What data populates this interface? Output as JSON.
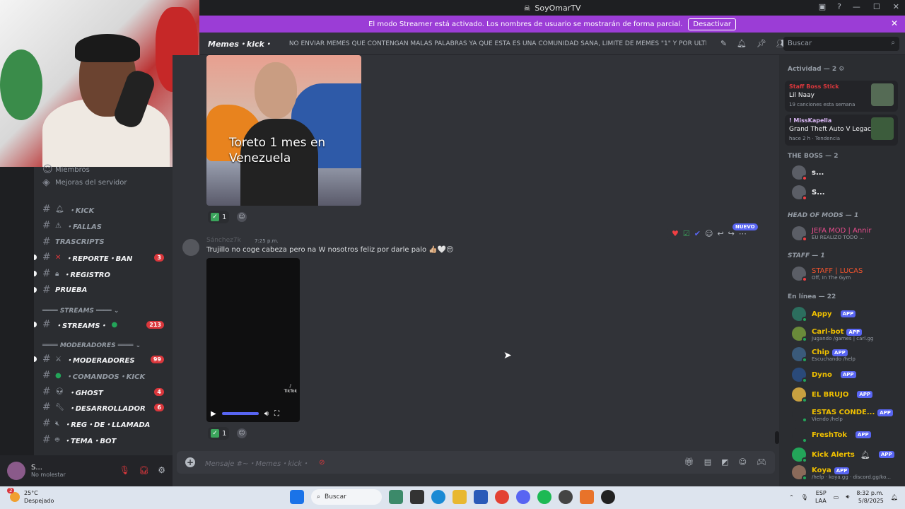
{
  "window": {
    "title": "SoyOmarTV"
  },
  "banner": {
    "text": "El modo Streamer está activado. Los nombres de usuario se mostrarán de forma parcial.",
    "button": "Desactivar"
  },
  "channel_header": {
    "name": "Memes・kick・",
    "topic": "NO ENVIAR MEMES QUE CONTENGAN MALAS PALABRAS YA QUE ESTA ES UNA COMUNIDAD SANA, LIMITE DE MEMES \"1\" Y POR ULTIMO EL ...",
    "search_placeholder": "Buscar"
  },
  "sidebar": {
    "partial_item": "Miembros",
    "boost_item": "Mejoras del servidor",
    "channels": [
      {
        "label": "・KICK",
        "badge": ""
      },
      {
        "label": "・FALLAS",
        "badge": ""
      },
      {
        "label": "TRASCRIPTS",
        "badge": ""
      },
      {
        "label": "・REPORTE・BAN",
        "badge": "3"
      },
      {
        "label": "・REGISTRO",
        "badge": ""
      },
      {
        "label": "PRUEBA",
        "badge": ""
      },
      {
        "label": "・STREAMS・",
        "badge": "213"
      },
      {
        "label": "・MODERADORES",
        "badge": "99"
      },
      {
        "label": "・COMANDOS・KICK",
        "badge": ""
      },
      {
        "label": "・GHOST",
        "badge": "4"
      },
      {
        "label": "・DESARROLLADOR",
        "badge": "6"
      },
      {
        "label": "・REG・DE・LLAMADA",
        "badge": ""
      },
      {
        "label": "・TEMA・BOT",
        "badge": ""
      }
    ],
    "categories": [
      "STREAMS",
      "MODERADORES"
    ],
    "user": {
      "name": "S...",
      "status": "No molestar"
    }
  },
  "chat": {
    "meme_caption": "Toreto 1 mes en Venezuela",
    "reaction_count_1": "1",
    "message2": {
      "author": "Sánchez7k",
      "time": "7:25 p.m.",
      "text": "Trujillo no coge cabeza pero na W nosotros feliz por darle palo"
    },
    "reaction_count_2": "1",
    "new_badge": "NUEVO",
    "video_watermark": "TikTok"
  },
  "input": {
    "placeholder": "Mensaje #~・Memes・kick・"
  },
  "members": {
    "activity_header": "Actividad — 2",
    "activities": [
      {
        "user": "Staff Boss Stick",
        "title": "Lil Naay",
        "detail": "19 canciones esta semana"
      },
      {
        "user": "! MissKapella",
        "title": "Grand Theft Auto V Legacy",
        "detail": "hace 2 h  ·  Tendencia"
      }
    ],
    "groups": [
      {
        "header": "THE BOSS — 2",
        "members": [
          {
            "name": "s...",
            "sub": ""
          },
          {
            "name": "S...",
            "sub": ""
          }
        ]
      },
      {
        "header": "HEAD OF MODS — 1",
        "members": [
          {
            "name": "JEFA MOD | Annir",
            "sub": "EU REALIZO TODO ..."
          }
        ]
      },
      {
        "header": "STAFF — 1",
        "members": [
          {
            "name": "STAFF | LUCAS",
            "sub": "Off, In The Gym"
          }
        ]
      },
      {
        "header": "En línea — 22",
        "members": [
          {
            "name": "Appy",
            "sub": ""
          },
          {
            "name": "Carl-bot",
            "sub": "Jugando /games | carl.gg"
          },
          {
            "name": "Chip",
            "sub": "Escuchando /help"
          },
          {
            "name": "Dyno",
            "sub": ""
          },
          {
            "name": "EL BRUJO",
            "sub": ""
          },
          {
            "name": "ESTAS CONDE...",
            "sub": "Viendo /help"
          },
          {
            "name": "FreshTok",
            "sub": ""
          },
          {
            "name": "Kick Alerts",
            "sub": ""
          },
          {
            "name": "Koya",
            "sub": "/help · koya.gg · discord.gg/ko..."
          }
        ]
      }
    ],
    "app_label": "APP"
  },
  "taskbar": {
    "temp": "25°C",
    "weather": "Despejado",
    "search": "Buscar",
    "lang1": "ESP",
    "lang2": "LAA",
    "time": "8:32 p.m.",
    "date": "5/8/2025",
    "notif": "2"
  },
  "colors": {
    "banner": "#9b3dd6",
    "accent": "#5865f2",
    "danger": "#da373c",
    "online": "#23a559"
  }
}
